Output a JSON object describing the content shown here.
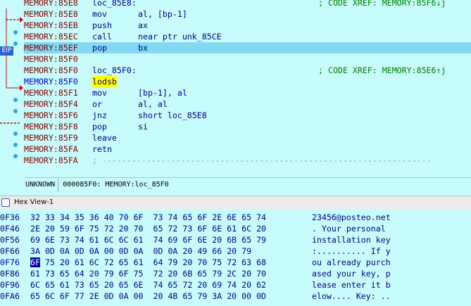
{
  "disasm": {
    "lines": [
      {
        "addr": "MEMORY:85E8",
        "label": "loc_85E8:",
        "xref": "; CODE XREF: MEMORY:85F6↓j"
      },
      {
        "addr": "MEMORY:85E8",
        "mnemonic": "mov",
        "operands": "al, [bp-1]"
      },
      {
        "addr": "MEMORY:85EB",
        "mnemonic": "push",
        "operands": "ax"
      },
      {
        "addr": "MEMORY:85EC",
        "mnemonic": "call",
        "operands": "near ptr unk_85CE"
      },
      {
        "addr": "MEMORY:85EF",
        "mnemonic": "pop",
        "operands": "bx"
      },
      {
        "addr": "MEMORY:85F0"
      },
      {
        "addr": "MEMORY:85F0",
        "label": "loc_85F0:",
        "xref": "; CODE XREF: MEMORY:85E6↑j"
      },
      {
        "addr": "MEMORY:85F0",
        "mnemonic": "lodsb",
        "operands": ""
      },
      {
        "addr": "MEMORY:85F1",
        "mnemonic": "mov",
        "operands": "[bp-1], al"
      },
      {
        "addr": "MEMORY:85F4",
        "mnemonic": "or",
        "operands": "al, al"
      },
      {
        "addr": "MEMORY:85F6",
        "mnemonic": "jnz",
        "operands": "short loc_85E8"
      },
      {
        "addr": "MEMORY:85F8",
        "mnemonic": "pop",
        "operands": "si"
      },
      {
        "addr": "MEMORY:85F9",
        "mnemonic": "leave",
        "operands": ""
      },
      {
        "addr": "MEMORY:85FA",
        "mnemonic": "retn",
        "operands": ""
      },
      {
        "addr": "MEMORY:85FA",
        "separator": "; -------------------------------------------------------------------"
      }
    ],
    "eip_label": "EIP",
    "colors": {
      "highlight": "#84d8f4",
      "address": "#800000",
      "xref": "#008000",
      "arrow": "#d00000"
    }
  },
  "status": {
    "segment": "UNKNOWN",
    "offset": "000085F0: MEMORY:loc_85F0"
  },
  "hexview": {
    "title": "Hex View-1",
    "rows": [
      {
        "addr": "0F36",
        "bytes": "32 33 34 35 36 40 70 6F  73 74 65 6F 2E 6E 65 74",
        "ascii": "23456@posteo.net"
      },
      {
        "addr": "0F46",
        "bytes": "2E 20 59 6F 75 72 20 70  65 72 73 6F 6E 61 6C 20",
        "ascii": ". Your personal "
      },
      {
        "addr": "0F56",
        "bytes": "69 6E 73 74 61 6C 6C 61  74 69 6F 6E 20 6B 65 79",
        "ascii": "installation key"
      },
      {
        "addr": "0F66",
        "bytes": "3A 0D 0A 0D 0A 00 0D 0A  0D 0A 20 49 66 20 79",
        "ascii": ":.......... If y"
      },
      {
        "addr": "0F76",
        "cursor_byte": "6F",
        "bytes": " 75 20 61 6C 72 65 61  64 79 20 70 75 72 63 68",
        "ascii": "ou already purch"
      },
      {
        "addr": "0F86",
        "bytes": "61 73 65 64 20 79 6F 75  72 20 6B 65 79 2C 20 70",
        "ascii": "ased your key, p"
      },
      {
        "addr": "0F96",
        "bytes": "6C 65 61 73 65 20 65 6E  74 65 72 20 69 74 20 62",
        "ascii": "lease enter it b"
      },
      {
        "addr": "0FA6",
        "bytes": "65 6C 6F 77 2E 0D 0A 00  20 4B 65 79 3A 20 00 0D",
        "ascii": "elow.... Key: .."
      }
    ]
  }
}
